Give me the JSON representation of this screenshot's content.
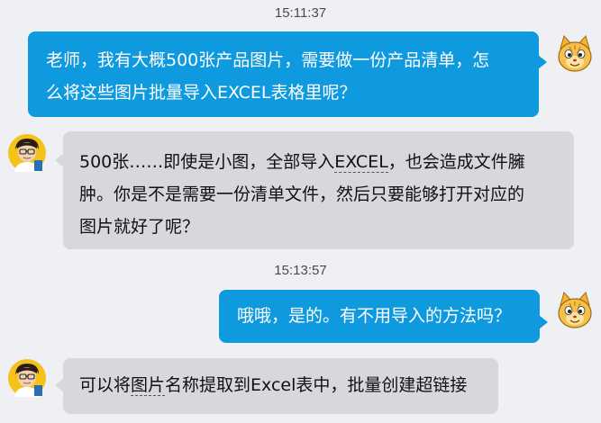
{
  "timestamps": [
    "15:11:37",
    "15:13:57"
  ],
  "messages": [
    {
      "sender": "me",
      "lines": [
        "老师，我有大概500张产品图片，需要做一份产品清单，怎",
        "么将这些图片批量导入EXCEL表格里呢？"
      ]
    },
    {
      "sender": "teacher",
      "line1_a": "500张……即使是小图，全部导入",
      "line1_link": "EXCEL",
      "line1_b": "，也会造成文件臃",
      "line2": "肿。你是不是需要一份清单文件，然后只要能够打开对应的",
      "line3": "图片就好了呢？"
    },
    {
      "sender": "me",
      "lines": [
        "哦哦，是的。有不用导入的方法吗？"
      ]
    },
    {
      "sender": "teacher",
      "line1_a": "可以将",
      "line1_link": "图片",
      "line1_b": "名称提取到Excel表中，批量创建超链接"
    }
  ],
  "avatars": {
    "me": "cat-avatar-icon",
    "teacher": "teacher-avatar-icon"
  },
  "colors": {
    "background": "#eef0f3",
    "my_bubble": "#0f9ae0",
    "their_bubble": "#d6d8dc"
  }
}
